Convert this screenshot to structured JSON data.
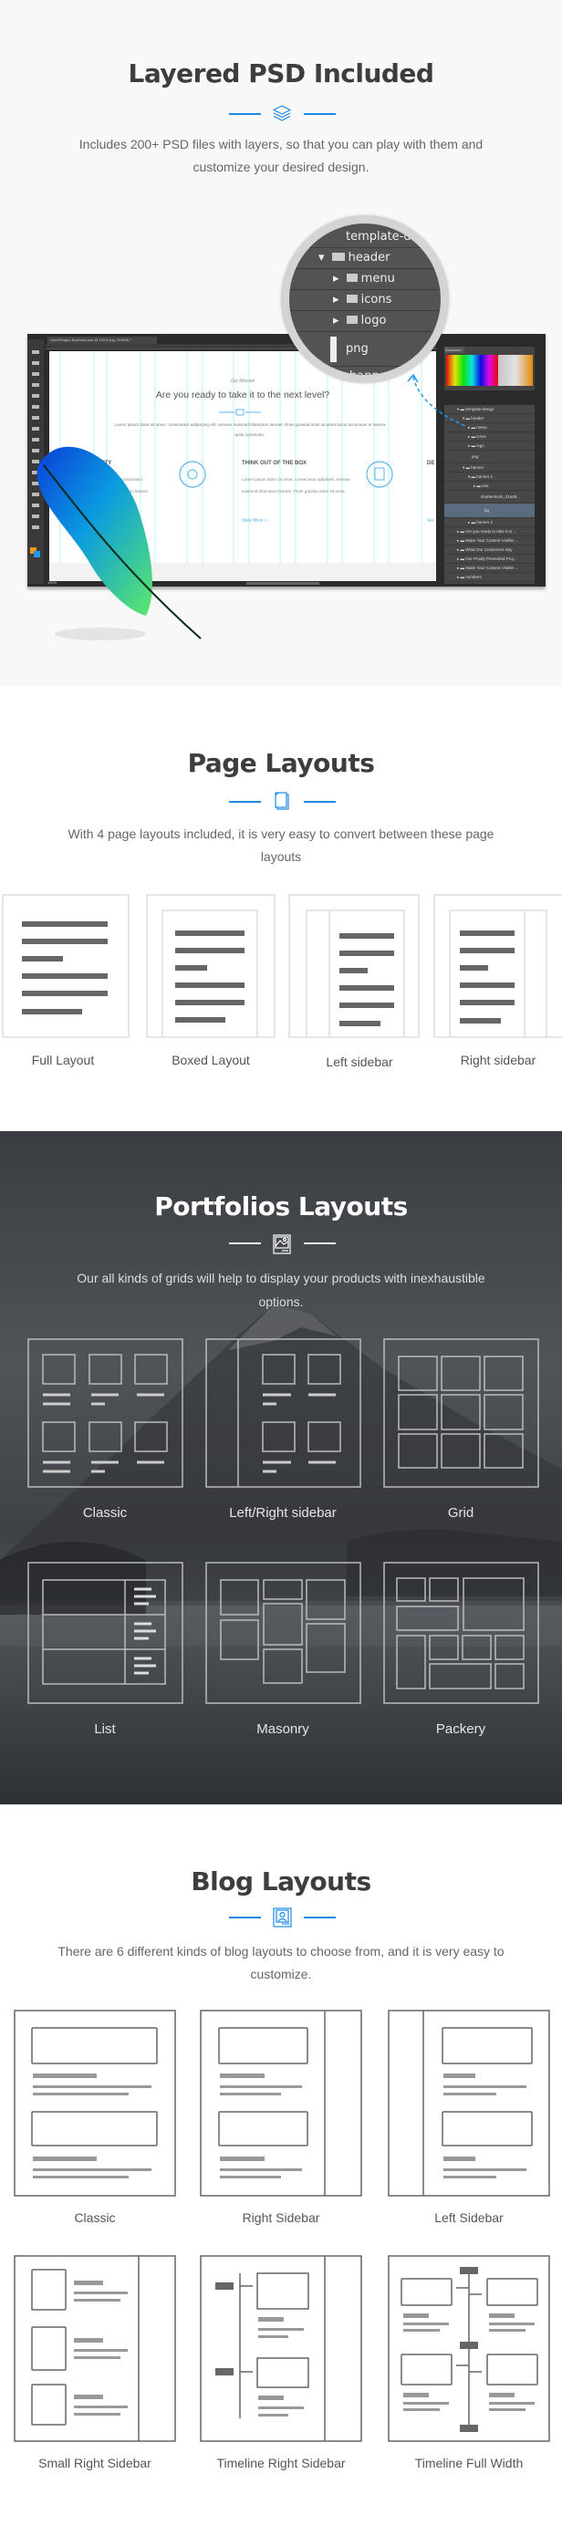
{
  "colors": {
    "accent": "#1e88e5",
    "text": "#3d3d3d",
    "muted": "#666666",
    "dark_bg": "#3b3e42"
  },
  "psd": {
    "title": "Layered PSD Included",
    "icon": "layers-icon",
    "description": "Includes 200+ PSD files with layers, so that you can play with them and customize your desired design.",
    "photoshop": {
      "doc_tab": "HomePage2-Business.psd @ 100% (bg, RGB/8) *",
      "zoom": "100%",
      "canvas": {
        "eyebrow": "Our Mission",
        "heading": "Are you ready to take it to the next level?",
        "lorem": "Lorem ipsum dolor sit amet, consectetur adipiscing elit. Aenean euismod bibendum laoreet. Proin gravida dolor sit amet lacus accumsan et viverra justo commodo.",
        "columns": [
          {
            "heading": "ENTITY",
            "body": "sit amet, consectetur smod bibendum laoreet. met lacus."
          },
          {
            "heading": "THINK OUT OF THE BOX",
            "body": "Lorem ipsum dolor sit amet, consectetur adipiselit. Aenean euismod bibendum laoreet. Proin gravida dolor sit amet.",
            "link": "View More >"
          },
          {
            "heading": "DE",
            "body": "Lor adi Pro",
            "link": "Vie"
          }
        ]
      },
      "swatches_tab": "Swatches",
      "layers": [
        "template-dnngo",
        "header",
        "menu",
        "icons",
        "logo",
        "png",
        "banner",
        "banner 1",
        "text",
        "shutterstock_31649...",
        "bg",
        "banner 2",
        "Are you ready to take it to ...",
        "Make Your Content Visible ...",
        "What Our Customers Say",
        "Our Prodly Presented Proj...",
        "Make Your Content Visible ...",
        "numbers"
      ],
      "magnifier": [
        "template-dnngo",
        "header",
        "menu",
        "icons",
        "logo",
        "png",
        "banner"
      ]
    }
  },
  "page_layouts": {
    "title": "Page Layouts",
    "icon": "pages-icon",
    "description": "With 4 page layouts included, it is very easy to convert between these page layouts",
    "items": [
      "Full Layout",
      "Boxed Layout",
      "Left sidebar",
      "Right sidebar"
    ]
  },
  "portfolio_layouts": {
    "title": "Portfolios Layouts",
    "icon": "image-icon",
    "description": "Our all kinds of grids will help to display your products with inexhaustible options.",
    "items": [
      "Classic",
      "Left/Right sidebar",
      "Grid",
      "List",
      "Masonry",
      "Packery"
    ]
  },
  "blog_layouts": {
    "title": "Blog Layouts",
    "icon": "portrait-icon",
    "description": "There are 6 different kinds of blog layouts to choose from, and it is very easy to customize.",
    "items": [
      "Classic",
      "Right Sidebar",
      "Left Sidebar",
      "Small Right Sidebar",
      "Timeline Right Sidebar",
      "Timeline Full Width"
    ]
  }
}
